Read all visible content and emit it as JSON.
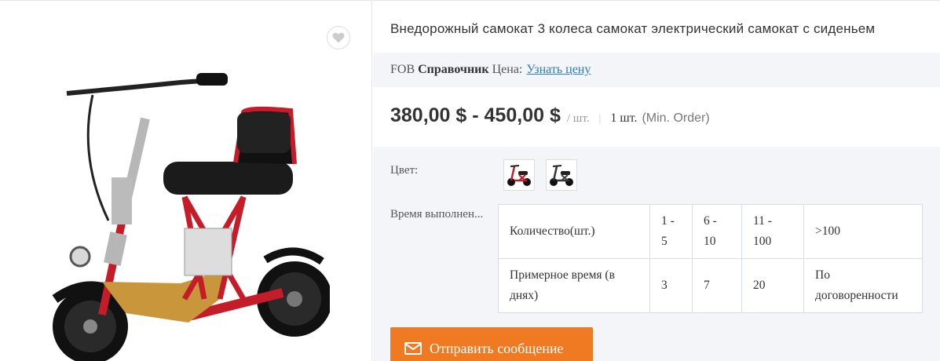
{
  "product": {
    "title": "Внедорожный самокат 3 колеса самокат электрический самокат с сиденьем"
  },
  "fob": {
    "prefix": "FOB",
    "bold": "Справочник",
    "label": "Цена:",
    "link": "Узнать цену"
  },
  "price": {
    "range": "380,00 $ - 450,00 $",
    "unit": "/ шт.",
    "min_qty": "1 шт.",
    "min_note": "(Min. Order)"
  },
  "attributes": {
    "color_label": "Цвет:",
    "lead_label": "Время выполнен..."
  },
  "lead_table": {
    "row1": [
      "Количество(шт.)",
      "1 - 5",
      "6 - 10",
      "11 - 100",
      ">100"
    ],
    "row2": [
      "Примерное время (в днях)",
      "3",
      "7",
      "20",
      "По договоренности"
    ]
  },
  "actions": {
    "send": "Отправить сообщение"
  },
  "icons": {
    "favorite": "heart-icon",
    "send": "envelope-icon"
  },
  "colors": {
    "accent": "#f07a22",
    "link": "#2d7bc1",
    "panel_bg": "#f3f5f9"
  }
}
